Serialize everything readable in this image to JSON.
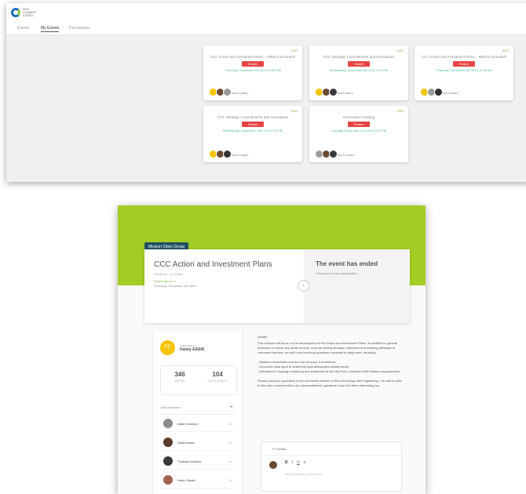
{
  "top": {
    "logo_text": "NYC CLIMATE CITIES",
    "tabs": [
      "Events",
      "My Events",
      "Discussions"
    ],
    "edit_label": "EDIT",
    "cards": [
      {
        "title": "CCC Action and Investment Plans – What is Included?",
        "badge": "Ended",
        "date": "Thursday, November 1st 2023 10:00 PM",
        "others": "and 10 others"
      },
      {
        "title": "CCC Strategic Commitments and Innovations",
        "badge": "Ended",
        "date": "Wednesday, November 8th 2023 2:00 PM",
        "others": "and 8 others"
      },
      {
        "title": "CCC Action and Investment Plans – What is Included?",
        "badge": "Ended",
        "date": "Thursday, November 9th 2023 10:00 AM",
        "others": "and 6 others"
      },
      {
        "title": "CCC Strategic Commitments and Innovations",
        "badge": "Ended",
        "date": "Wednesday, November 15th 2023 2:00 PM",
        "others": "and 14 others"
      },
      {
        "title": "Consortium meeting",
        "badge": "Ended",
        "date": "Tuesday, November 21st 2023 3:00 PM",
        "others": "and 10 others"
      }
    ]
  },
  "event": {
    "org_tag": "Mission Cities Group",
    "title": "CCC Action and Investment Plans",
    "time": "10:00 am - 11:30 am",
    "scheduled": "Scheduled on 1",
    "date": "Thursday, November 1st 2023",
    "ended_title": "The event has ended",
    "ended_sub": "Thank you for your participation"
  },
  "organizer": {
    "organized_by": "Organized by",
    "name": "Fanny EASIS",
    "initials": "FE",
    "stats": [
      {
        "value": "346",
        "label": "INVITED"
      },
      {
        "value": "104",
        "label": "PARTICIPANTS"
      }
    ],
    "members_label": "Joint Members",
    "members": [
      {
        "name": "Adam Harrison",
        "role": "Co"
      },
      {
        "name": "Sofia Ivanov",
        "role": "Co"
      },
      {
        "name": "Thomas Hedlund",
        "role": "Co"
      },
      {
        "name": "Helen Sadler",
        "role": "Co"
      }
    ]
  },
  "details": {
    "heading": "Details",
    "body": "This session will focus on the development of the Action and Investment Plans. In addition to general questions on these key areas of work, such as setting strategic objectives and building pathways to overcome barriers, we will cover technical questions essential to daily work, including:\n\n- Baseline inventories and the role of scope 3 emissions;\n- Economic data input to determine total anticipated capital needs;\n- Activities for ongoing monitoring and evaluation at the city level, consistent with Mission requirements.\n\nPlease post your questions in the comments section of this event page after registering. You will be able to like and comment other city representatives' questions if you feel them interesting too."
  },
  "composer": {
    "tab_label": "Publish",
    "tools": [
      "B",
      "I",
      "U",
      "≡"
    ],
    "placeholder": "Write something about you..."
  }
}
